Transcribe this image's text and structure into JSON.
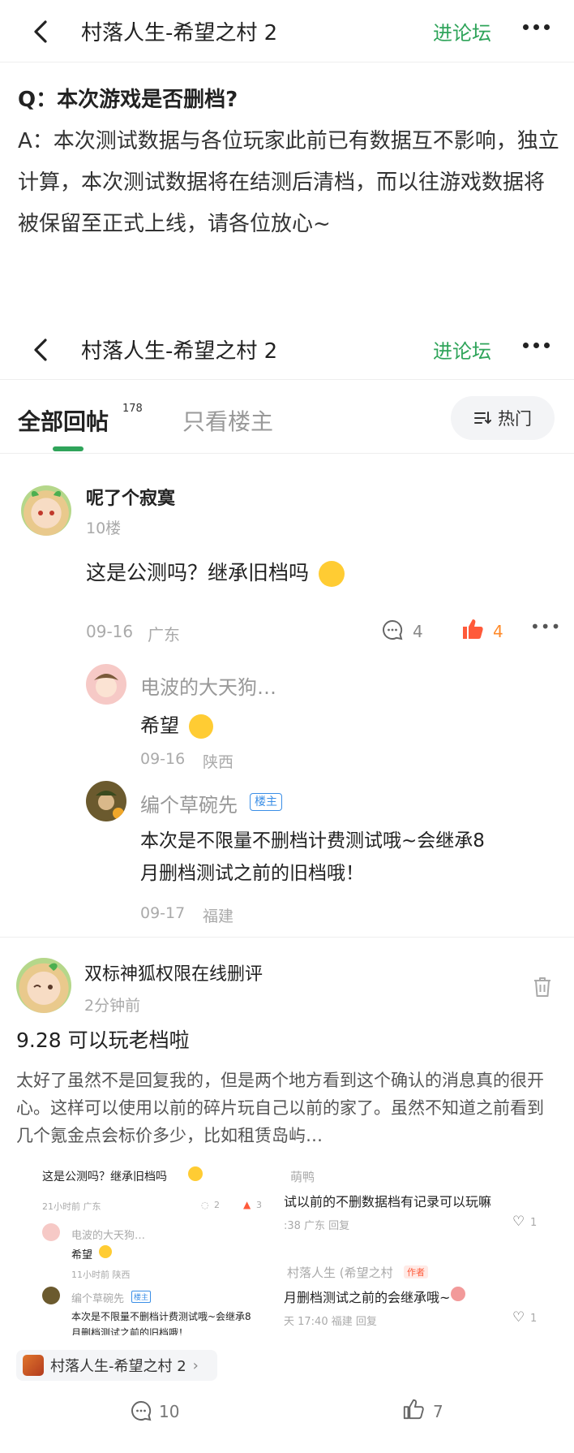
{
  "header": {
    "title": "村落人生-希望之村 2",
    "forum_link": "进论坛"
  },
  "faq": {
    "question": "Q：本次游戏是否删档?",
    "answer": "A：本次测试数据与各位玩家此前已有数据互不影响，独立计算，本次测试数据将在结测后清档，而以往游戏数据将被保留至正式上线，请各位放心~"
  },
  "tabs": {
    "all_label": "全部回帖",
    "all_count": "178",
    "owner_label": "只看楼主",
    "sort_label": "热门"
  },
  "floor10": {
    "user": "呢了个寂寞",
    "floor": "10楼",
    "content": "这是公测吗？继承旧档吗",
    "date": "09-16",
    "region": "广东",
    "comments": "4",
    "likes": "4",
    "replies": [
      {
        "user": "电波的大天狗…",
        "content": "希望",
        "date": "09-16",
        "region": "陕西"
      },
      {
        "user": "编个草碗先",
        "tag": "楼主",
        "content_line1": "本次是不限量不删档计费测试哦~会继承8",
        "content_line2": "月删档测试之前的旧档哦！",
        "date": "09-17",
        "region": "福建"
      }
    ]
  },
  "post": {
    "user": "双标神狐权限在线删评",
    "time": "2分钟前",
    "title": "9.28 可以玩老档啦",
    "body": "太好了虽然不是回复我的，但是两个地方看到这个确认的消息真的很开心。这样可以使用以前的碎片玩自己以前的家了。虽然不知道之前看到几个氪金点会标价多少，比如租赁岛屿…",
    "thumb_left": {
      "q": "这是公测吗？继承旧档吗",
      "meta": "21小时前  广东",
      "c": "2",
      "l": "3",
      "r1_user": "电波的大天狗…",
      "r1_text": "希望",
      "r1_meta": "11小时前  陕西",
      "r2_user": "编个草碗先",
      "r2_tag": "楼主",
      "r2_text": "本次是不限量不删档计费测试哦~会继承8",
      "r2_text2": "月删档测试之前的旧档哦！"
    },
    "thumb_right": {
      "u1": "萌鸭",
      "t1": "试以前的不删数据档有记录可以玩嘛",
      "m1": ":38 广东  回复",
      "l1": "1",
      "u2": "村落人生 (希望之村",
      "tag2": "作者",
      "t2": "月删档测试之前的会继承哦~",
      "m2": "天 17:40  福建  回复",
      "l2": "1"
    },
    "game_chip": "村落人生-希望之村 2",
    "comments": "10",
    "likes": "7"
  },
  "colors": {
    "accent": "#2fa45a",
    "like": "#ff5a3a",
    "tag": "#3a8ee6"
  }
}
